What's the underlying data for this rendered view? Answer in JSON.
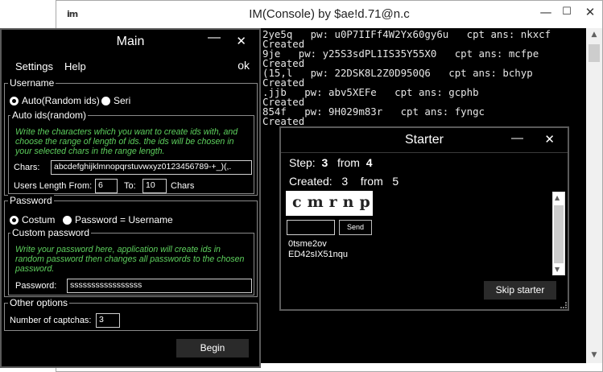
{
  "console": {
    "icon": "console-icon",
    "title": "IM(Console) by $ae!d.71@n.c",
    "controls": {
      "minimize": "—",
      "maximize": "☐",
      "close": "✕"
    },
    "lines": [
      "2ye5q   pw: u0P7IIFf4W2Yx60gy6u   cpt ans: nkxcf",
      "Created",
      "9je   pw: y25S3sdPL1IS35Y55X0   cpt ans: mcfpe",
      "Created",
      "(15,l   pw: 22DSK8L2Z0D950Q6   cpt ans: bchyp",
      "Created",
      ".jjb   pw: abv5XEFe   cpt ans: gcphb",
      "Created",
      "854f   pw: 9H029m83r   cpt ans: fyngc",
      "Created"
    ]
  },
  "main": {
    "title": "Main",
    "controls": {
      "minimize": "—",
      "close": "✕"
    },
    "menu": {
      "settings": "Settings",
      "help": "Help",
      "ok": "ok"
    },
    "username": {
      "group_label": "Username",
      "radio_auto": "Auto(Random ids)",
      "radio_seri": "Seri",
      "selected": "auto",
      "auto_group_label": "Auto ids(random)",
      "hint": "Write the characters which you want to create ids with, and choose the range of length of ids. the ids will be chosen in your selected chars in the range length.",
      "chars_label": "Chars:",
      "chars_value": "abcdefghijklmnopqrstuvwxyz0123456789-+_)(,.",
      "length_from_label": "Users Length From:",
      "length_from_value": "6",
      "to_label": "To:",
      "to_value": "10",
      "chars_unit": "Chars"
    },
    "password": {
      "group_label": "Password",
      "radio_custom": "Costum",
      "radio_same": "Password = Username",
      "selected": "custom",
      "custom_group_label": "Custom password",
      "hint": "Write your password here, application will create ids in random password then changes all passwords to the chosen password.",
      "password_label": "Password:",
      "password_value": "sssssssssssssssss"
    },
    "other": {
      "group_label": "Other options",
      "captchas_label": "Number of captchas:",
      "captchas_value": "3"
    },
    "begin_label": "Begin"
  },
  "starter": {
    "title": "Starter",
    "controls": {
      "minimize": "—",
      "close": "✕"
    },
    "step_label": "Step:",
    "step_value": "3",
    "step_from": "from",
    "step_total": "4",
    "created_label": "Created:",
    "created_value": "3",
    "created_from": "from",
    "created_total": "5",
    "captcha_text": "cmrnp",
    "captcha_input": "",
    "send_label": "Send",
    "accounts": [
      "0tsme2ov",
      "ED42sIX51nqu"
    ],
    "skip_label": "Skip starter"
  },
  "colors": {
    "window_bg": "#000000",
    "hint_green": "#5dd05d",
    "button_bg": "#2a2a2a"
  }
}
